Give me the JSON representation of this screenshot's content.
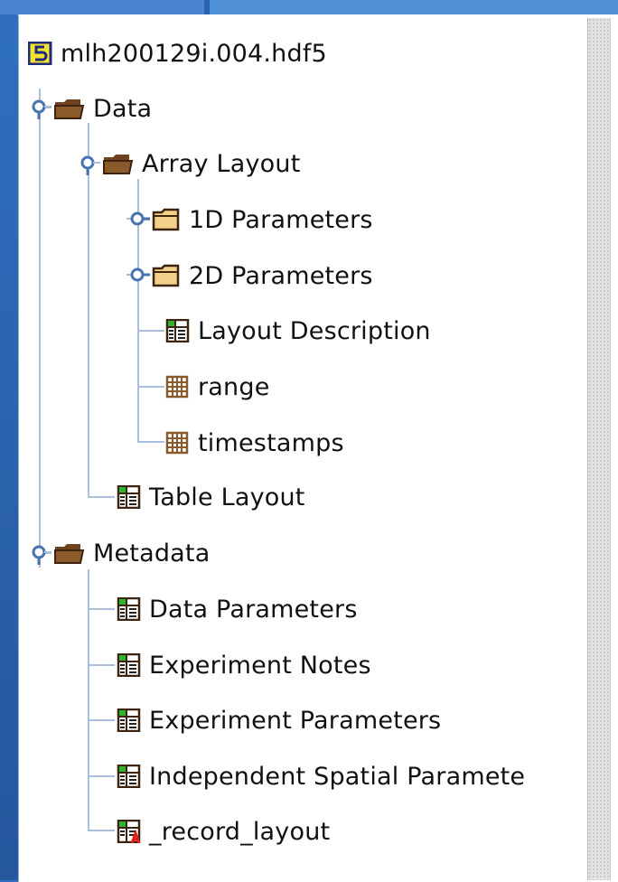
{
  "tree": {
    "root": {
      "label": "mlh200129i.004.hdf5",
      "icon": "hdf5-file-icon"
    },
    "nodes": [
      {
        "label": "Data",
        "icon": "folder-open-icon",
        "depth": 1,
        "expanded": true
      },
      {
        "label": "Array Layout",
        "icon": "folder-open-icon",
        "depth": 2,
        "expanded": true
      },
      {
        "label": "1D Parameters",
        "icon": "folder-closed-icon",
        "depth": 3,
        "expanded": false
      },
      {
        "label": "2D Parameters",
        "icon": "folder-closed-icon",
        "depth": 3,
        "expanded": false
      },
      {
        "label": "Layout Description",
        "icon": "table-icon",
        "depth": 3
      },
      {
        "label": "range",
        "icon": "dataset-icon",
        "depth": 3
      },
      {
        "label": "timestamps",
        "icon": "dataset-icon",
        "depth": 3
      },
      {
        "label": "Table Layout",
        "icon": "table-icon",
        "depth": 2
      },
      {
        "label": "Metadata",
        "icon": "folder-open-icon",
        "depth": 1,
        "expanded": true
      },
      {
        "label": "Data Parameters",
        "icon": "table-icon",
        "depth": 2
      },
      {
        "label": "Experiment Notes",
        "icon": "table-icon",
        "depth": 2
      },
      {
        "label": "Experiment Parameters",
        "icon": "table-icon",
        "depth": 2
      },
      {
        "label": "Independent Spatial Paramete",
        "icon": "table-icon",
        "depth": 2
      },
      {
        "label": "_record_layout",
        "icon": "table-attr-icon",
        "depth": 2
      }
    ]
  },
  "colors": {
    "background": "#2a62ac",
    "tree_line": "#a9bfdc",
    "folder": "#8b5a2b",
    "folder_closed": "#f3d08a"
  }
}
